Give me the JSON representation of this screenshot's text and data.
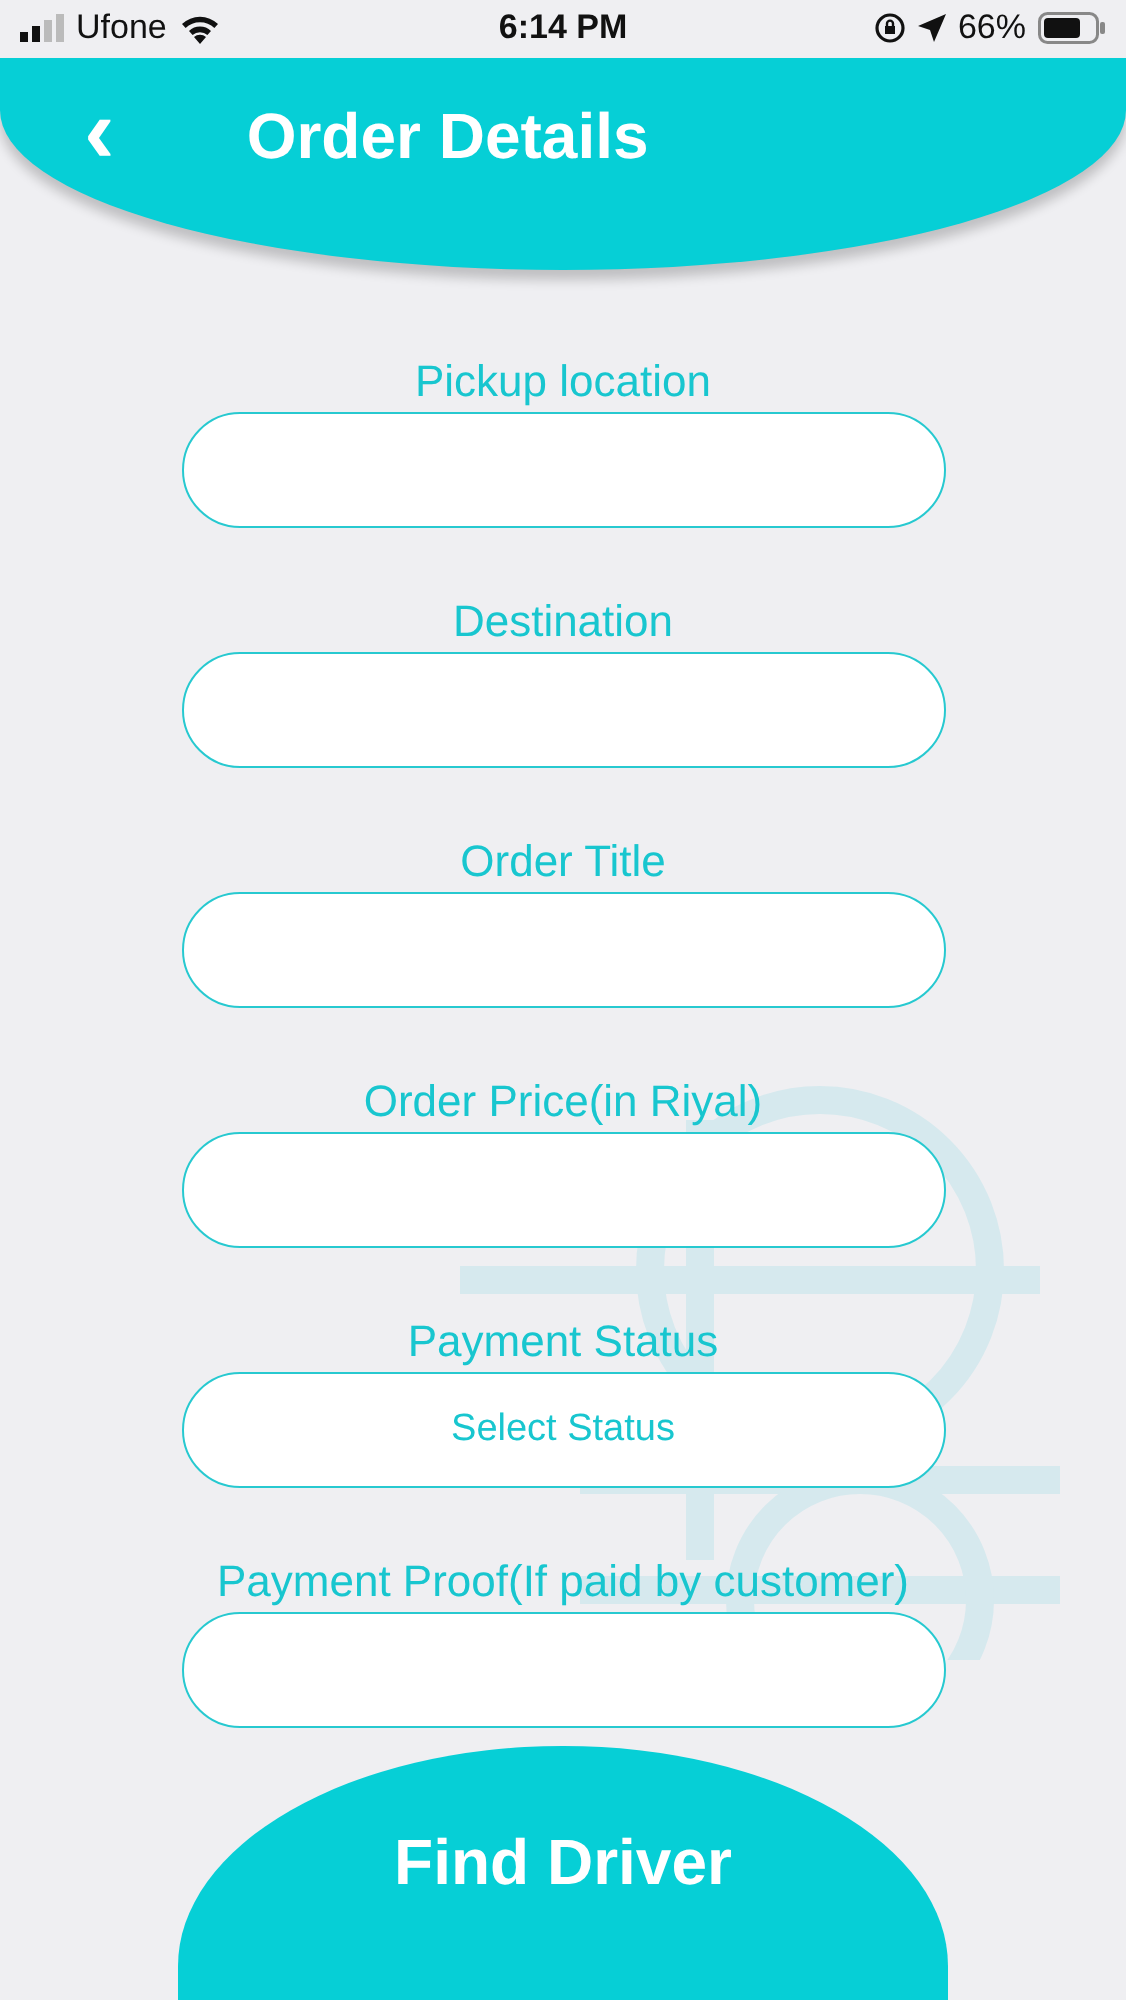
{
  "status_bar": {
    "carrier": "Ufone",
    "time": "6:14 PM",
    "battery": "66%"
  },
  "header": {
    "back": "‹",
    "title": "Order Details"
  },
  "fields": [
    {
      "label": "Pickup location",
      "kind": "text"
    },
    {
      "label": "Destination",
      "kind": "text"
    },
    {
      "label": "Order Title",
      "kind": "text"
    },
    {
      "label": "Order Price(in Riyal)",
      "kind": "text"
    },
    {
      "label": "Payment Status",
      "kind": "select",
      "value": "Select Status"
    },
    {
      "label": "Payment Proof(If paid by customer)",
      "kind": "text"
    }
  ],
  "action_button": {
    "label": "Find Driver"
  }
}
